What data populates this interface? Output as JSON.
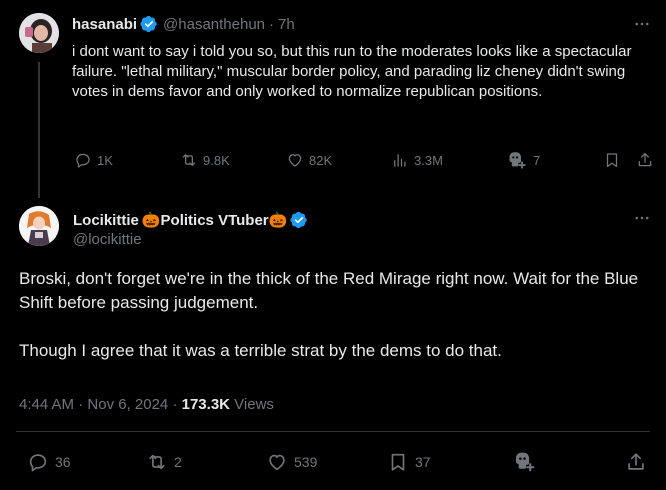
{
  "parent_tweet": {
    "author_name": "hasanabi",
    "author_handle": "@hasanthehun",
    "separator": "·",
    "time_ago": "7h",
    "text": "i dont want to say i told you so, but this run to the moderates looks like a spectacular failure. \"lethal military,\" muscular border policy, and parading liz cheney didn't swing votes in dems favor and only worked to normalize republican positions.",
    "actions": {
      "replies": "1K",
      "reposts": "9.8K",
      "likes": "82K",
      "views": "3.3M",
      "grok": "7"
    }
  },
  "reply_tweet": {
    "author_name": "Locikittie",
    "author_tag": "Politics VTuber",
    "pumpkin_emoji": "🎃",
    "author_handle": "@locikittie",
    "text": "Broski, don't forget we're in the thick of the Red Mirage right now. Wait for the Blue Shift before passing judgement.\n\nThough I agree that it was a terrible strat by the dems to do that.",
    "time": "4:44 AM",
    "separator": "·",
    "date": "Nov 6, 2024",
    "separator2": "·",
    "views_count": "173.3K",
    "views_label": "Views",
    "actions": {
      "replies": "36",
      "reposts": "2",
      "likes": "539",
      "bookmarks": "37"
    }
  },
  "colors": {
    "background": "#000000",
    "text": "#e7e9ea",
    "muted": "#71767b",
    "verified_blue": "#1d9bf0",
    "divider": "#2f3336"
  },
  "icons": {
    "verified": "verified-badge-icon",
    "more": "more-horizontal-icon",
    "reply": "reply-icon",
    "repost": "repost-icon",
    "like": "heart-icon",
    "views": "analytics-icon",
    "grok": "grok-icon",
    "bookmark": "bookmark-icon",
    "share": "share-icon"
  }
}
